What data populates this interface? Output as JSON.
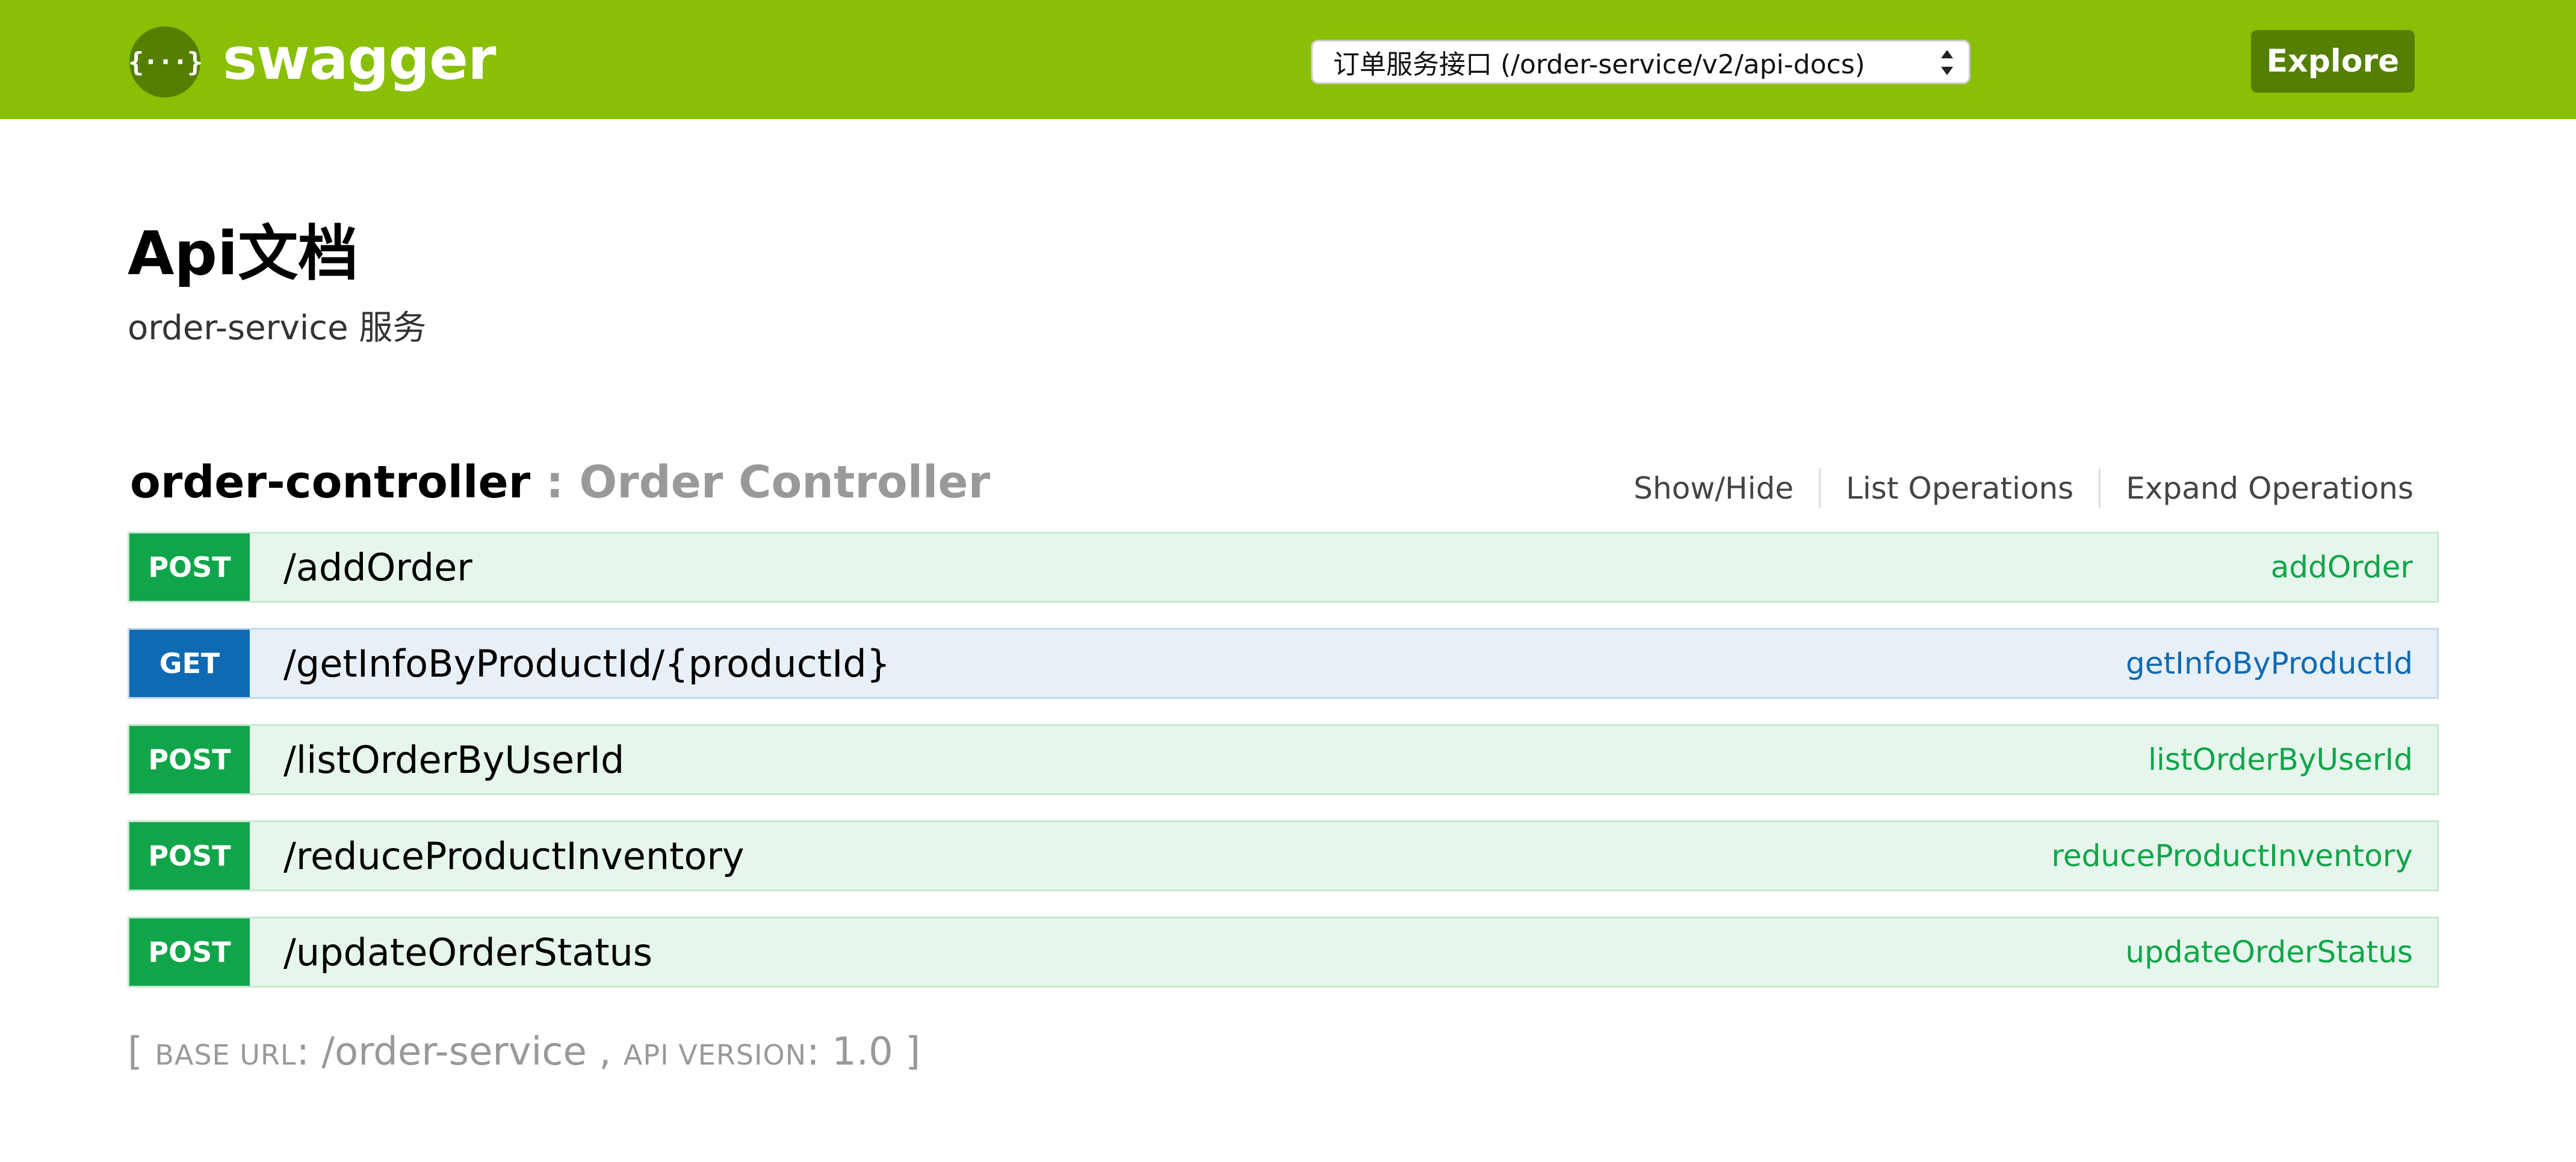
{
  "header": {
    "logo_glyph": "{···}",
    "logo_text": "swagger",
    "api_select_value": "订单服务接口 (/order-service/v2/api-docs)",
    "explore_label": "Explore",
    "colors": {
      "background": "#89bf04",
      "dark": "#547f00"
    }
  },
  "info": {
    "title": "Api文档",
    "description": "order-service 服务"
  },
  "resource": {
    "name": "order-controller",
    "separator": " : ",
    "description": "Order Controller",
    "actions": [
      "Show/Hide",
      "List Operations",
      "Expand Operations"
    ]
  },
  "operations": [
    {
      "method": "POST",
      "path": "/addOrder",
      "nickname": "addOrder"
    },
    {
      "method": "GET",
      "path": "/getInfoByProductId/{productId}",
      "nickname": "getInfoByProductId"
    },
    {
      "method": "POST",
      "path": "/listOrderByUserId",
      "nickname": "listOrderByUserId"
    },
    {
      "method": "POST",
      "path": "/reduceProductInventory",
      "nickname": "reduceProductInventory"
    },
    {
      "method": "POST",
      "path": "/updateOrderStatus",
      "nickname": "updateOrderStatus"
    }
  ],
  "footer": {
    "open": "[ ",
    "base_url_label": "BASE URL",
    "base_url_value": ": /order-service , ",
    "api_version_label": "API VERSION",
    "api_version_value": ": 1.0 ]"
  },
  "colors": {
    "post": "#10a54a",
    "get": "#0f6ab4"
  }
}
